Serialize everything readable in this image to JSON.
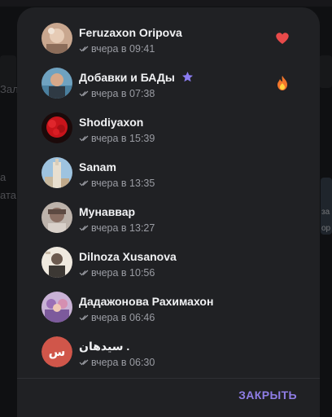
{
  "background": {
    "text_left_1": "а",
    "text_left_2": "ата",
    "text_left_3": "Зал",
    "text_right_1": "за",
    "text_right_2": "ор"
  },
  "dialog": {
    "rows": [
      {
        "name": "Feruzaxon Oripova",
        "status": "вчера в 09:41",
        "reaction": "heart-icon"
      },
      {
        "name": "Добавки и БАДы",
        "status": "вчера в 07:38",
        "reaction": "fire-icon",
        "badge": "star-icon"
      },
      {
        "name": "Shodiyaxon",
        "status": "вчера в 15:39"
      },
      {
        "name": "Sanam",
        "status": "вчера в 13:35"
      },
      {
        "name": "Мунаввар",
        "status": "вчера в 13:27"
      },
      {
        "name": "Dilnoza Xusanova",
        "status": "вчера в 10:56"
      },
      {
        "name": "Дадажонова Рахимахон",
        "status": "вчера в 06:46"
      },
      {
        "name": "سیدهان .",
        "status": "вчера в 06:30",
        "initial": "س"
      }
    ],
    "close_label": "ЗАКРЫТЬ"
  },
  "colors": {
    "accent": "#8f7de6",
    "avatar_initial_bg": "#d0564a",
    "heart": "#e84a4a",
    "star": "#8b7cf2"
  }
}
